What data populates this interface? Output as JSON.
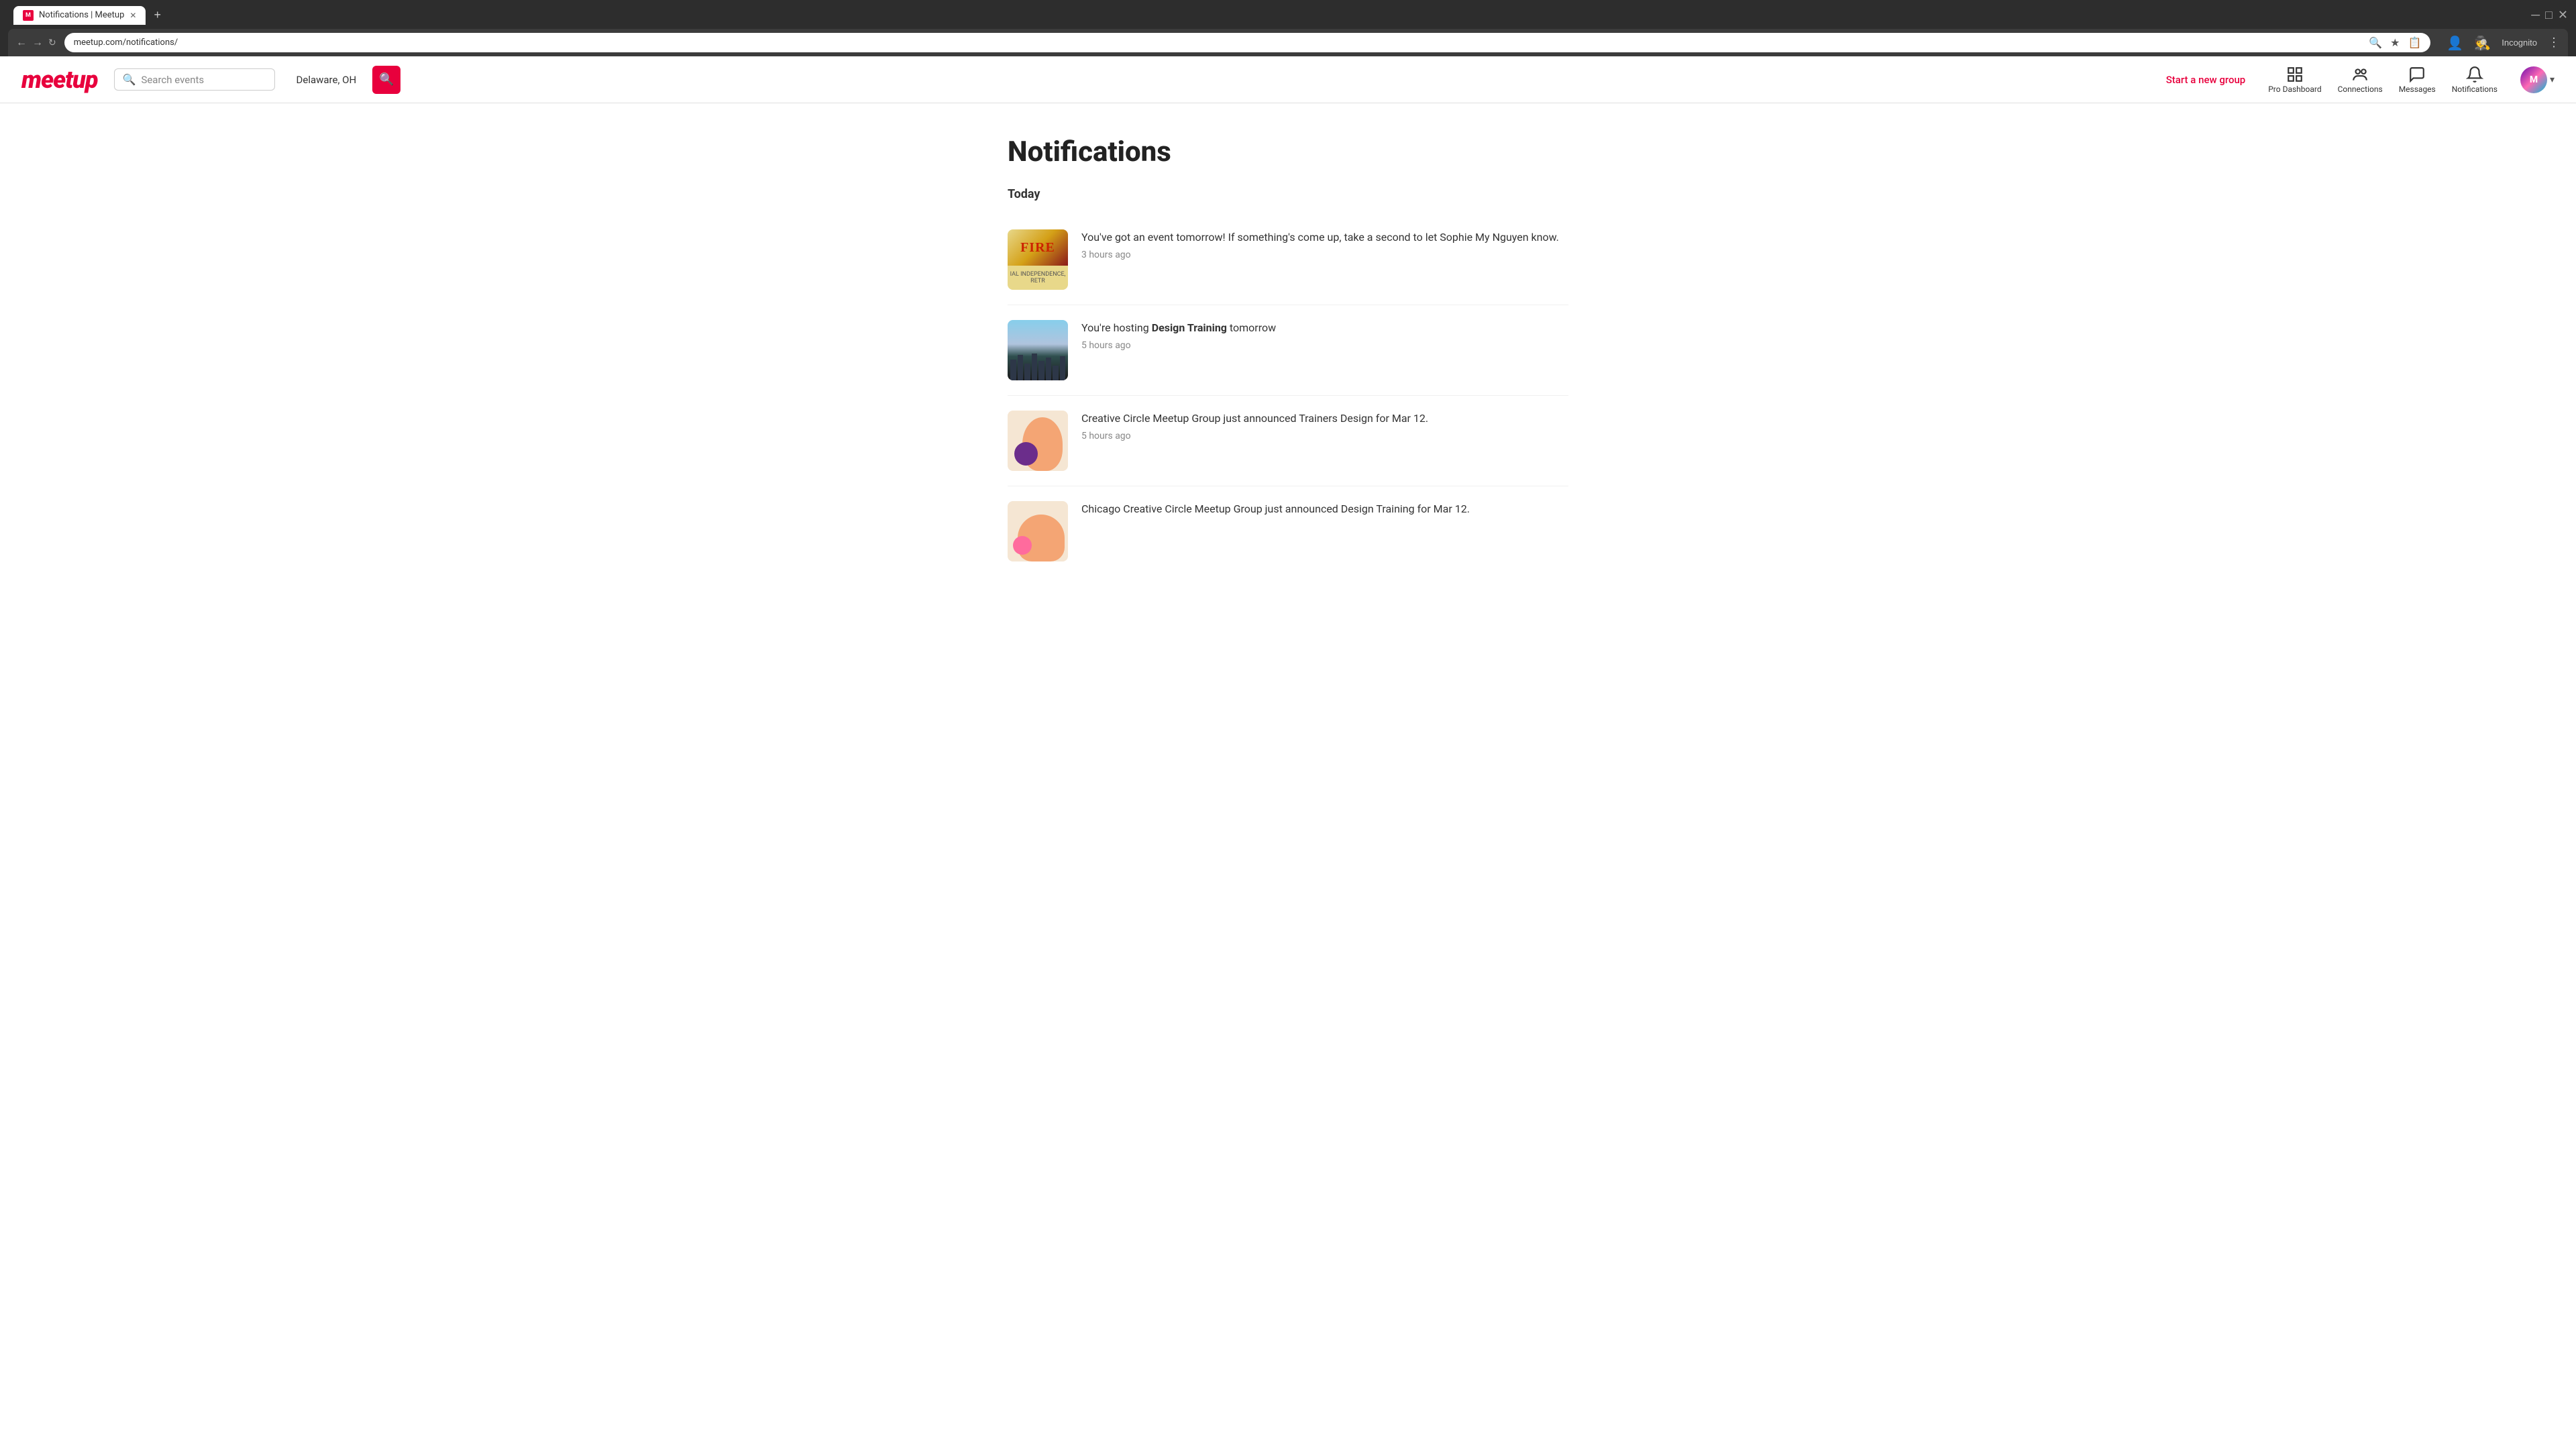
{
  "browser": {
    "tab_title": "Notifications | Meetup",
    "tab_favicon": "M",
    "url": "meetup.com/notifications/",
    "new_tab_label": "+",
    "nav": {
      "back_disabled": false,
      "forward_disabled": false
    },
    "address_bar_icons": [
      "🔍",
      "★",
      "📋"
    ],
    "incognito_label": "Incognito",
    "menu_label": "⋮"
  },
  "header": {
    "logo_text": "meetup",
    "search_placeholder": "Search events",
    "location": "Delaware, OH",
    "start_group": "Start a new group",
    "nav_items": [
      {
        "id": "pro-dashboard",
        "label": "Pro Dashboard"
      },
      {
        "id": "connections",
        "label": "Connections"
      },
      {
        "id": "messages",
        "label": "Messages"
      },
      {
        "id": "notifications",
        "label": "Notifications"
      }
    ]
  },
  "page": {
    "title": "Notifications",
    "section": "Today",
    "notifications": [
      {
        "id": "n1",
        "thumb_type": "fire",
        "message_plain": "You've got an event tomorrow! If something's come up, take a second to let Sophie My Nguyen know.",
        "message_bold": "",
        "time": "3 hours ago"
      },
      {
        "id": "n2",
        "thumb_type": "city",
        "message_pre": "You're hosting ",
        "message_bold": "Design Training",
        "message_post": " tomorrow",
        "time": "5 hours ago"
      },
      {
        "id": "n3",
        "thumb_type": "creative",
        "message_plain": "Creative Circle Meetup Group just announced Trainers Design for Mar 12.",
        "message_bold": "",
        "time": "5 hours ago"
      },
      {
        "id": "n4",
        "thumb_type": "chicago",
        "message_plain": "Chicago Creative Circle Meetup Group just announced Design Training for Mar 12.",
        "message_bold": "",
        "time": ""
      }
    ]
  }
}
